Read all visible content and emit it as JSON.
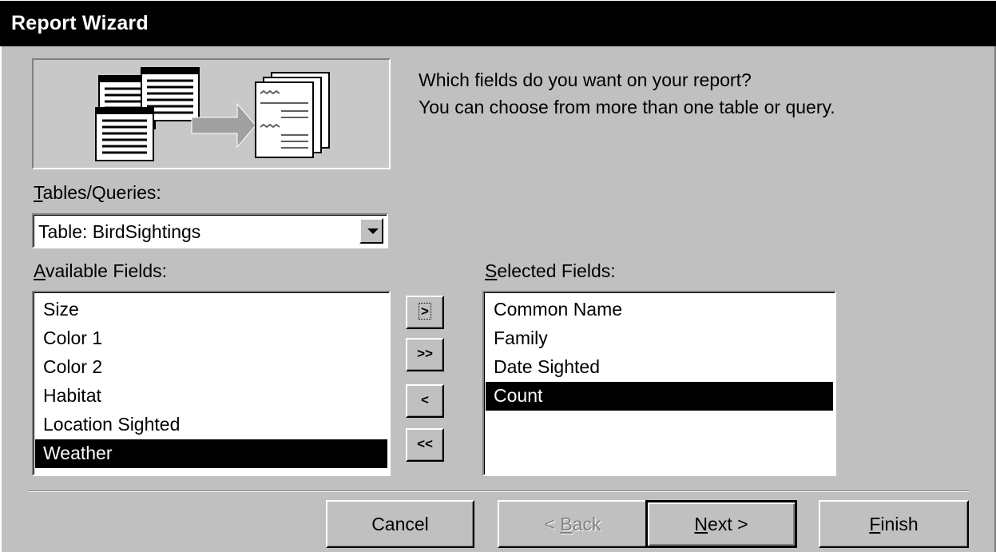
{
  "window": {
    "title": "Report Wizard"
  },
  "prompt": {
    "line1": "Which fields do you want on your report?",
    "line2": "You can choose from more than one table or query."
  },
  "tables_queries": {
    "label_mnemonic": "T",
    "label_rest": "ables/Queries:",
    "selected": "Table: BirdSightings"
  },
  "available_fields": {
    "label_mnemonic": "A",
    "label_rest": "vailable Fields:",
    "items": [
      "Size",
      "Color 1",
      "Color 2",
      "Habitat",
      "Location Sighted",
      "Weather"
    ],
    "selected_item": "Weather"
  },
  "selected_fields": {
    "label_mnemonic": "S",
    "label_rest": "elected Fields:",
    "items": [
      "Common Name",
      "Family",
      "Date Sighted",
      "Count"
    ],
    "selected_item": "Count"
  },
  "move_buttons": {
    "add_one": ">",
    "add_all": ">>",
    "remove_one": "<",
    "remove_all": "<<"
  },
  "buttons": {
    "cancel": "Cancel",
    "back_prefix": "< ",
    "back_mnemonic": "B",
    "back_rest": "ack",
    "next_mnemonic": "N",
    "next_rest": "ext >",
    "finish_mnemonic": "F",
    "finish_rest": "inish"
  },
  "colors": {
    "title_bg": "#000000",
    "face": "#c0c0c0",
    "selection": "#000000"
  }
}
